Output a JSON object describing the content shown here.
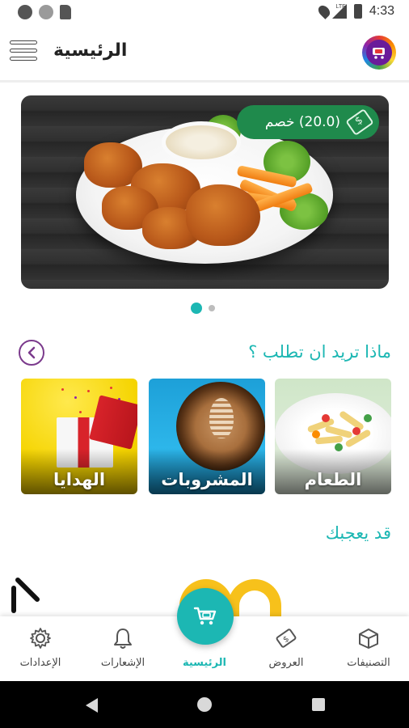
{
  "status_bar": {
    "time": "4:33",
    "network": "LTE",
    "icons": [
      "chat-icon",
      "circle-icon",
      "sd-card-icon",
      "location-icon",
      "signal-icon",
      "battery-icon"
    ]
  },
  "app_bar": {
    "title": "الرئيسية",
    "menu_icon": "hamburger-menu-icon",
    "logo_icon": "cart-logo-icon"
  },
  "banner": {
    "discount_text": "(20.0) خصم",
    "discount_icon": "price-tag-icon",
    "pill_color": "#1f8a4c",
    "slide_count": 2,
    "active_slide": 1
  },
  "categories": {
    "title": "ماذا تريد ان تطلب ؟",
    "nav_icon": "chevron-left-icon",
    "items": [
      {
        "label": "الهدايا",
        "image": "gift-box-image"
      },
      {
        "label": "المشروبات",
        "image": "coffee-cup-image"
      },
      {
        "label": "الطعام",
        "image": "pasta-plate-image"
      }
    ]
  },
  "suggestions": {
    "title": "قد يعجبك"
  },
  "bottom_nav": {
    "items": [
      {
        "label": "الإعدادات",
        "icon": "gear-icon",
        "active": false
      },
      {
        "label": "الإشعارات",
        "icon": "bell-icon",
        "active": false
      },
      {
        "label": "الرئيسية",
        "icon": "cart-icon",
        "active": true
      },
      {
        "label": "العروض",
        "icon": "price-tag-icon",
        "active": false
      },
      {
        "label": "التصنيفات",
        "icon": "box-icon",
        "active": false
      }
    ]
  },
  "theme": {
    "accent": "#1cb7b3",
    "purple": "#7b3a8c",
    "banner_pill": "#1f8a4c"
  }
}
